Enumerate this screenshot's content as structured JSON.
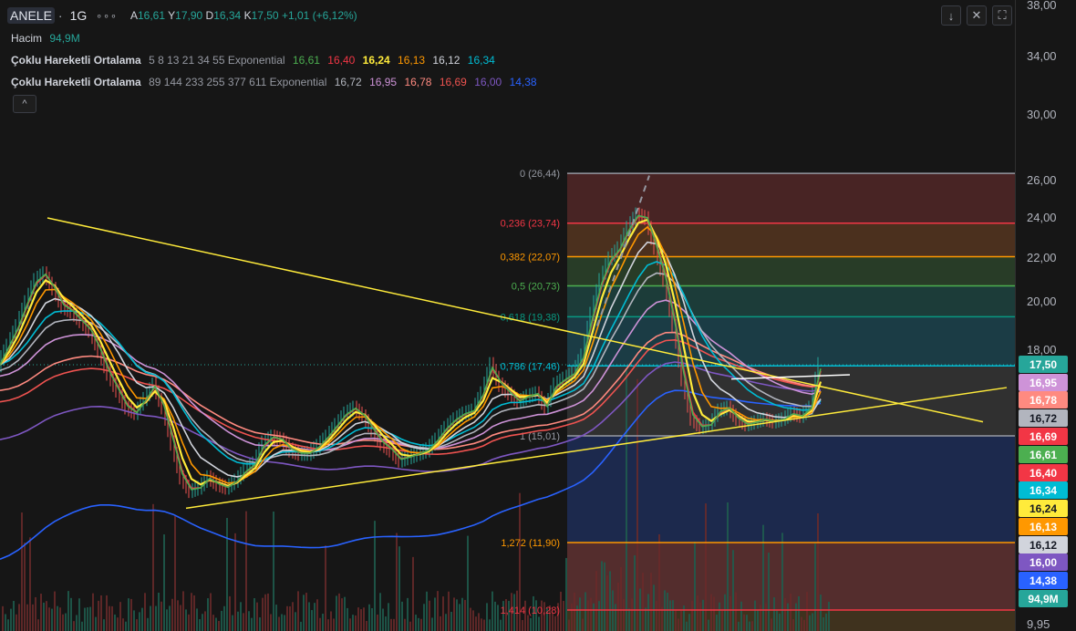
{
  "header": {
    "symbol": "ANELE",
    "timeframe": "1G",
    "more": "∘∘∘",
    "ohlc": [
      {
        "key": "A",
        "value": "16,61"
      },
      {
        "key": "Y",
        "value": "17,90"
      },
      {
        "key": "D",
        "value": "16,34"
      },
      {
        "key": "K",
        "value": "17,50"
      }
    ],
    "change": "+1,01 (+6,12%)"
  },
  "legend": {
    "volume": {
      "label": "Hacim",
      "value": "94,9M",
      "color": "#26a69a"
    },
    "ema1": {
      "label": "Çoklu Hareketli Ortalama",
      "params": "5 8 13 21 34 55 Exponential",
      "values": [
        {
          "v": "16,61",
          "color": "#4caf50"
        },
        {
          "v": "16,40",
          "color": "#f23645"
        },
        {
          "v": "16,24",
          "color": "#ffeb3b"
        },
        {
          "v": "16,13",
          "color": "#ff9800"
        },
        {
          "v": "16,12",
          "color": "#d1d4dc"
        },
        {
          "v": "16,34",
          "color": "#00bcd4"
        }
      ]
    },
    "ema2": {
      "label": "Çoklu Hareketli Ortalama",
      "params": "89 144 233 255 377 611 Exponential",
      "values": [
        {
          "v": "16,72",
          "color": "#b2b5be"
        },
        {
          "v": "16,95",
          "color": "#ce93d8"
        },
        {
          "v": "16,78",
          "color": "#ff8a80"
        },
        {
          "v": "16,69",
          "color": "#ef5350"
        },
        {
          "v": "16,00",
          "color": "#7e57c2"
        },
        {
          "v": "14,38",
          "color": "#2962ff"
        }
      ]
    }
  },
  "toolbar": {
    "down": "↓",
    "collapse_all": "✕",
    "fullscreen": "⛶",
    "legend_toggle": "^"
  },
  "chart_data": {
    "type": "line",
    "ylim": [
      9.5,
      38
    ],
    "y_axis_ticks": [
      "38,00",
      "34,00",
      "30,00",
      "26,00",
      "24,00",
      "22,00",
      "20,00",
      "18,00",
      "9,95"
    ],
    "price_line": {
      "last": 17.5
    },
    "fibonacci": [
      {
        "level": "0",
        "price": 26.44,
        "label": "0 (26,44)",
        "color": "#9598a1"
      },
      {
        "level": "0.236",
        "price": 23.74,
        "label": "0,236 (23,74)",
        "color": "#f23645"
      },
      {
        "level": "0.382",
        "price": 22.07,
        "label": "0,382 (22,07)",
        "color": "#ff9800"
      },
      {
        "level": "0.5",
        "price": 20.73,
        "label": "0,5 (20,73)",
        "color": "#4caf50"
      },
      {
        "level": "0.618",
        "price": 19.38,
        "label": "0,618 (19,38)",
        "color": "#089981"
      },
      {
        "level": "0.786",
        "price": 17.46,
        "label": "0,786 (17,46)",
        "color": "#00bcd4"
      },
      {
        "level": "1",
        "price": 15.01,
        "label": "1 (15,01)",
        "color": "#9598a1"
      },
      {
        "level": "1.272",
        "price": 11.9,
        "label": "1,272 (11,90)",
        "color": "#ff9800"
      },
      {
        "level": "1.414",
        "price": 10.28,
        "label": "1,414 (10,28)",
        "color": "#f23645"
      }
    ],
    "badges": [
      {
        "text": "17,50",
        "bg": "#26a69a",
        "fg": "#ffffff",
        "value": 17.5
      },
      {
        "text": "16,95",
        "bg": "#ce93d8",
        "fg": "#ffffff",
        "value": 16.95
      },
      {
        "text": "16,78",
        "bg": "#ff8a80",
        "fg": "#ffffff",
        "value": 16.78
      },
      {
        "text": "16,72",
        "bg": "#b2b5be",
        "fg": "#131722",
        "value": 16.72
      },
      {
        "text": "16,69",
        "bg": "#f23645",
        "fg": "#ffffff",
        "value": 16.69
      },
      {
        "text": "16,61",
        "bg": "#4caf50",
        "fg": "#ffffff",
        "value": 16.61
      },
      {
        "text": "16,40",
        "bg": "#f23645",
        "fg": "#ffffff",
        "value": 16.4
      },
      {
        "text": "16,34",
        "bg": "#00bcd4",
        "fg": "#ffffff",
        "value": 16.34
      },
      {
        "text": "16,24",
        "bg": "#ffeb3b",
        "fg": "#131722",
        "value": 16.24
      },
      {
        "text": "16,13",
        "bg": "#ff9800",
        "fg": "#ffffff",
        "value": 16.13
      },
      {
        "text": "16,12",
        "bg": "#d1d4dc",
        "fg": "#131722",
        "value": 16.12
      },
      {
        "text": "16,00",
        "bg": "#7e57c2",
        "fg": "#ffffff",
        "value": 16.0
      },
      {
        "text": "14,38",
        "bg": "#2962ff",
        "fg": "#ffffff",
        "value": 14.38
      },
      {
        "text": "94,9M",
        "bg": "#26a69a",
        "fg": "#ffffff",
        "value": 94.9
      }
    ],
    "price_series": {
      "x": [
        0,
        10,
        20,
        30,
        40,
        50,
        60,
        70,
        80,
        90,
        100,
        110,
        120,
        130,
        140,
        150,
        160,
        170,
        180,
        190,
        200,
        210,
        220,
        230,
        240,
        250,
        260,
        270,
        280,
        290,
        300,
        310,
        320,
        330,
        340,
        350,
        360,
        370,
        380,
        390,
        400,
        410,
        420,
        430,
        440,
        450,
        460,
        470,
        480,
        490,
        500,
        510,
        520,
        530,
        540,
        550,
        560,
        570,
        580,
        590,
        600,
        610,
        620,
        630,
        640,
        650,
        660,
        670,
        680,
        690,
        700,
        710,
        720,
        730,
        740,
        750,
        760,
        770,
        780,
        790,
        800,
        810,
        820,
        830,
        840,
        850,
        860,
        870,
        880,
        890,
        900
      ],
      "close": [
        17.5,
        18.2,
        19.0,
        20.0,
        21.0,
        21.3,
        20.6,
        19.8,
        19.6,
        19.2,
        18.8,
        18.0,
        17.2,
        16.6,
        16.0,
        15.8,
        16.3,
        16.8,
        16.0,
        14.8,
        13.8,
        13.4,
        13.5,
        13.8,
        13.6,
        13.5,
        13.7,
        14.0,
        14.2,
        14.8,
        15.0,
        14.9,
        14.6,
        14.5,
        14.5,
        14.7,
        15.0,
        15.4,
        15.8,
        16.0,
        15.7,
        15.2,
        14.8,
        14.6,
        14.3,
        14.4,
        14.5,
        14.6,
        14.9,
        15.3,
        15.6,
        15.8,
        15.9,
        16.5,
        17.5,
        16.8,
        16.5,
        16.2,
        16.4,
        16.5,
        16.0,
        16.8,
        17.0,
        17.2,
        17.8,
        19.5,
        21.0,
        22.0,
        22.5,
        23.5,
        24.2,
        24.0,
        22.5,
        21.0,
        19.0,
        17.0,
        15.6,
        15.3,
        15.4,
        15.9,
        16.0,
        15.6,
        15.4,
        15.5,
        15.6,
        15.5,
        15.6,
        15.8,
        15.7,
        16.0,
        17.5
      ]
    },
    "trendlines": [
      {
        "name": "descending",
        "from": [
          52,
          24.0
        ],
        "to": [
          1078,
          15.5
        ],
        "color": "#ffeb3b"
      },
      {
        "name": "ascending",
        "from": [
          204,
          12.9
        ],
        "to": [
          1104,
          16.7
        ],
        "color": "#ffeb3b"
      },
      {
        "name": "resistance",
        "from": [
          802,
          17.0
        ],
        "to": [
          932,
          17.15
        ],
        "color": "#ffffff"
      }
    ]
  }
}
